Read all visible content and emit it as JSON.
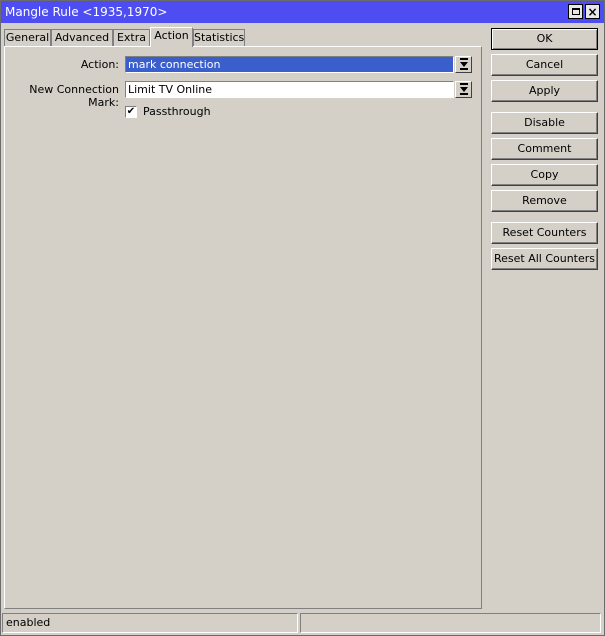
{
  "window": {
    "title": "Mangle Rule <1935,1970>"
  },
  "tabs": [
    {
      "label": "General"
    },
    {
      "label": "Advanced"
    },
    {
      "label": "Extra"
    },
    {
      "label": "Action"
    },
    {
      "label": "Statistics"
    }
  ],
  "active_tab": "Action",
  "form": {
    "action_label": "Action:",
    "action_value": "mark connection",
    "new_connection_mark_label": "New Connection Mark:",
    "new_connection_mark_value": "Limit TV Online",
    "passthrough_label": "Passthrough",
    "passthrough_checked": true,
    "check_glyph": "✔"
  },
  "buttons": [
    {
      "label": "OK"
    },
    {
      "label": "Cancel"
    },
    {
      "label": "Apply"
    },
    {
      "label": "Disable"
    },
    {
      "label": "Comment"
    },
    {
      "label": "Copy"
    },
    {
      "label": "Remove"
    },
    {
      "label": "Reset Counters"
    },
    {
      "label": "Reset All Counters"
    }
  ],
  "status": {
    "left": "enabled",
    "right": ""
  },
  "colors": {
    "titlebar": "#4d4df2",
    "selected_field": "#3a5fcd",
    "window_bg": "#d4d0c8"
  }
}
